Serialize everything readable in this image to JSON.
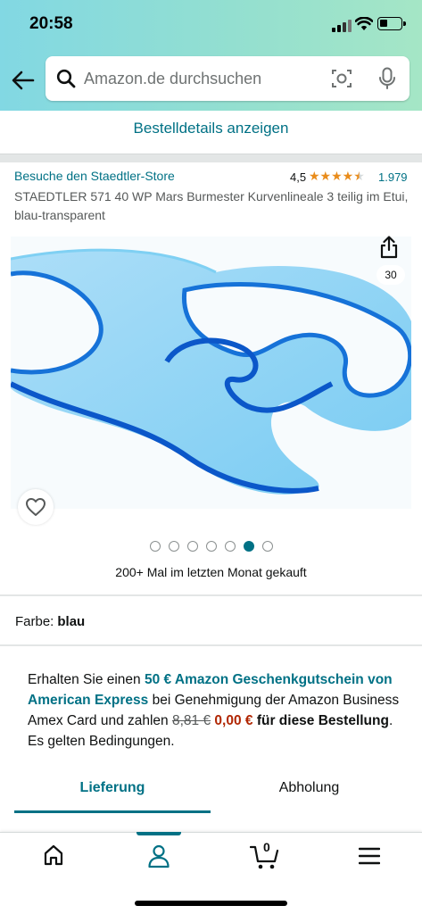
{
  "status_bar": {
    "time": "20:58"
  },
  "search": {
    "placeholder": "Amazon.de durchsuchen"
  },
  "order_details_link": "Bestelldetails anzeigen",
  "product": {
    "store_link": "Besuche den Staedtler-Store",
    "rating": "4,5",
    "stars": 4.5,
    "review_count": "1.979",
    "title": "STAEDTLER 571 40 WP Mars Burmester Kurvenlineale 3 teilig im Etui, blau-transparent",
    "image_count": "30",
    "image_dots_total": 7,
    "image_dots_active": 6,
    "bought_text": "200+ Mal im letzten Monat gekauft",
    "color_label": "Farbe:",
    "color_value": "blau"
  },
  "promo": {
    "text_1": "Erhalten Sie einen ",
    "link": "50 € Amazon Geschenkgutschein von American Express",
    "text_2": " bei Genehmigung der Amazon Business Amex Card und zahlen ",
    "old_price": "8,81 €",
    "new_price": "0,00 €",
    "text_3": " für diese Bestellung",
    "text_4": ". Es gelten Bedingungen."
  },
  "tabs": {
    "delivery": "Lieferung",
    "pickup": "Abholung"
  },
  "bottom_nav": {
    "cart_count": "0",
    "active_item": "account"
  },
  "colors": {
    "link": "#007185",
    "price": "#b12704",
    "star": "#e98c1b",
    "header_start": "#82d8e3",
    "header_end": "#a5e6c6"
  },
  "icons": [
    "back-arrow-icon",
    "search-icon",
    "camera-icon",
    "mic-icon",
    "share-icon",
    "heart-icon",
    "home-icon",
    "account-icon",
    "cart-icon",
    "menu-icon"
  ]
}
